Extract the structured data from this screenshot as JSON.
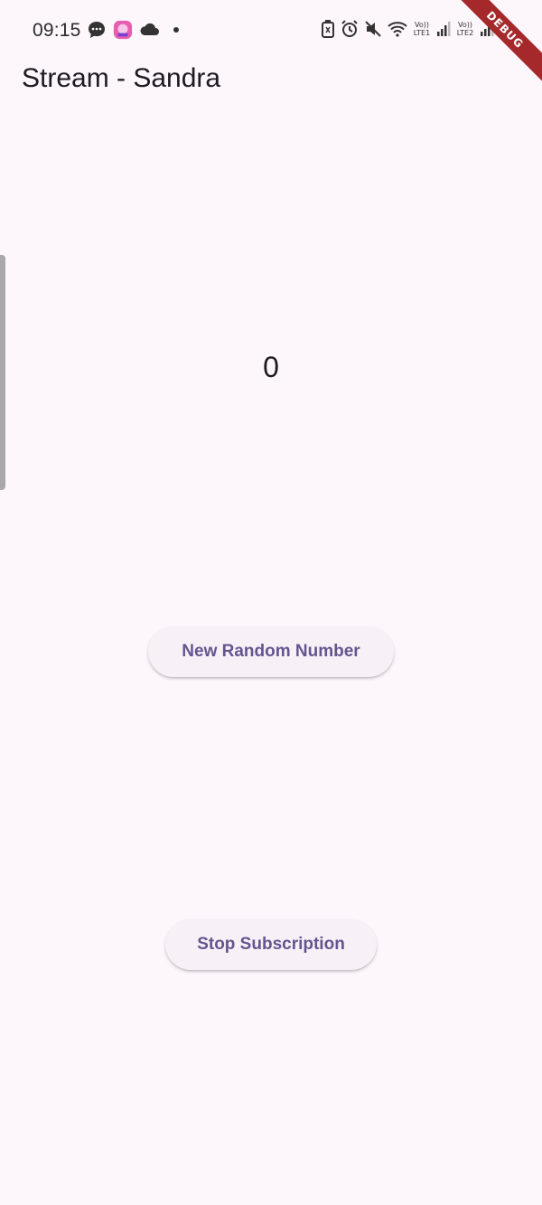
{
  "status_bar": {
    "time": "09:15",
    "sim1_label": "Vo)) LTE1",
    "sim2_label": "Vo)) LTE2"
  },
  "debug_banner": {
    "label": "DEBUG"
  },
  "app_bar": {
    "title": "Stream - Sandra"
  },
  "main": {
    "counter_value": "0",
    "new_random_button": "New Random Number",
    "stop_subscription_button": "Stop Subscription"
  },
  "colors": {
    "background": "#fdf6fb",
    "button_text": "#65558f",
    "button_bg": "#f7f1f7",
    "debug_ribbon": "#a5282b"
  }
}
